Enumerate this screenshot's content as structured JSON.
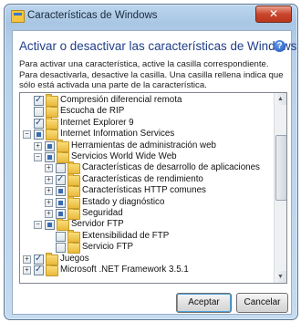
{
  "window": {
    "title": "Características de Windows",
    "close_label": "✕"
  },
  "dialog": {
    "heading": "Activar o desactivar las características de Windows",
    "description": "Para activar una característica, active la casilla correspondiente. Para desactivarla, desactive la casilla. Una casilla rellena indica que sólo está activada una parte de la característica."
  },
  "tree": {
    "items": [
      {
        "label": "Compresión diferencial remota",
        "state": "checked",
        "expandable": false
      },
      {
        "label": "Escucha de RIP",
        "state": "unchecked",
        "expandable": false
      },
      {
        "label": "Internet Explorer 9",
        "state": "checked",
        "expandable": false
      },
      {
        "label": "Internet Information Services",
        "state": "partial",
        "expandable": true,
        "expanded": true
      },
      {
        "label": "Herramientas de administración web",
        "state": "partial",
        "expandable": true,
        "expanded": false
      },
      {
        "label": "Servicios World Wide Web",
        "state": "partial",
        "expandable": true,
        "expanded": true
      },
      {
        "label": "Características de desarrollo de aplicaciones",
        "state": "unchecked",
        "expandable": true,
        "expanded": false
      },
      {
        "label": "Características de rendimiento",
        "state": "checked",
        "expandable": true,
        "expanded": false
      },
      {
        "label": "Características HTTP comunes",
        "state": "partial",
        "expandable": true,
        "expanded": false
      },
      {
        "label": "Estado y diagnóstico",
        "state": "partial",
        "expandable": true,
        "expanded": false
      },
      {
        "label": "Seguridad",
        "state": "partial",
        "expandable": true,
        "expanded": false
      },
      {
        "label": "Servidor FTP",
        "state": "partial",
        "expandable": true,
        "expanded": true
      },
      {
        "label": "Extensibilidad de FTP",
        "state": "unchecked",
        "expandable": false
      },
      {
        "label": "Servicio FTP",
        "state": "unchecked",
        "expandable": false
      },
      {
        "label": "Juegos",
        "state": "checked",
        "expandable": true,
        "expanded": false
      },
      {
        "label": "Microsoft .NET Framework 3.5.1",
        "state": "checked",
        "expandable": true,
        "expanded": false
      }
    ]
  },
  "buttons": {
    "ok": "Aceptar",
    "cancel": "Cancelar"
  },
  "icons": {
    "help": "?",
    "scroll_up": "▲",
    "scroll_down": "▼"
  }
}
